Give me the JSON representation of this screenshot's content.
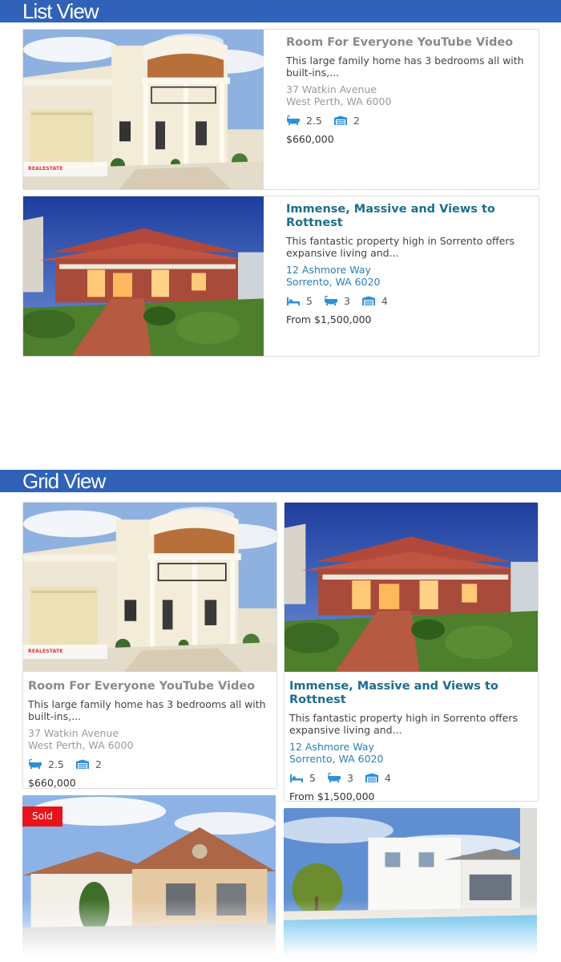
{
  "sections": {
    "list_title": "List View",
    "grid_title": "Grid View"
  },
  "listings": [
    {
      "title": "Room For Everyone YouTube Video",
      "description": "This large family home has 3 bedrooms all with built-ins,...",
      "address_line1": "37 Watkin Avenue",
      "address_line2": "West Perth, WA 6000",
      "baths": "2.5",
      "garages": "2",
      "price": "$660,000",
      "watermark": "REALESTATE"
    },
    {
      "title": "Immense, Massive and Views to Rottnest",
      "description": "This fantastic property high in Sorrento offers expansive living and...",
      "address_line1": "12 Ashmore Way",
      "address_line2": "Sorrento, WA 6020",
      "beds": "5",
      "baths": "3",
      "garages": "4",
      "price": "From $1,500,000"
    },
    {
      "badge": "Sold"
    },
    {}
  ],
  "icons": {
    "bed": "bed-icon",
    "bath": "bath-icon",
    "garage": "garage-icon"
  },
  "colors": {
    "section_bar": "#2f62b8",
    "title_grey": "#8a8a8a",
    "title_blue": "#1d6d8f",
    "link_blue": "#2a7fb8",
    "icon_blue": "#2f8fd6",
    "sold_red": "#e8141c"
  }
}
